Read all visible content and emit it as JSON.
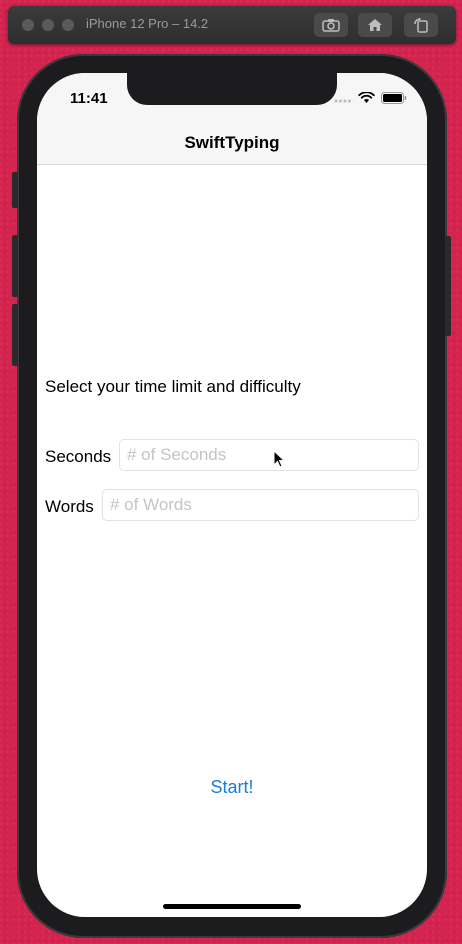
{
  "simulator": {
    "title": "iPhone 12 Pro – 14.2",
    "buttons": [
      "screenshot-icon",
      "home-icon",
      "rotate-icon"
    ]
  },
  "status_bar": {
    "time": "11:41",
    "icons": [
      "signal-icon",
      "wifi-icon",
      "battery-icon"
    ]
  },
  "nav": {
    "title": "SwiftTyping"
  },
  "main": {
    "prompt": "Select your time limit and difficulty",
    "seconds": {
      "label": "Seconds",
      "placeholder": "# of Seconds",
      "value": ""
    },
    "words": {
      "label": "Words",
      "placeholder": "# of Words",
      "value": ""
    },
    "start_label": "Start!"
  },
  "colors": {
    "background": "#d4234f",
    "accent": "#1a7ddc"
  }
}
